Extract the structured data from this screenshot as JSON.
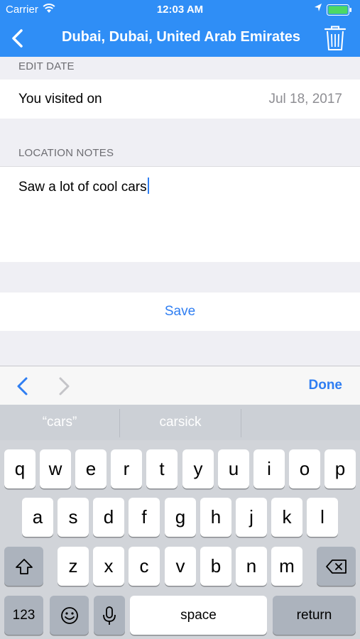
{
  "status_bar": {
    "carrier": "Carrier",
    "time": "12:03 AM"
  },
  "nav": {
    "title": "Dubai, Dubai, United Arab Emirates",
    "back_icon": "chevron-left-icon",
    "delete_icon": "trash-icon"
  },
  "edit_date": {
    "header": "EDIT DATE",
    "label": "You visited on",
    "value": "Jul 18, 2017"
  },
  "location_notes": {
    "header": "LOCATION NOTES",
    "text": "Saw a lot of cool cars"
  },
  "save_label": "Save",
  "toolbar": {
    "done_label": "Done"
  },
  "keyboard": {
    "suggestions": [
      "“cars”",
      "carsick",
      ""
    ],
    "row1": [
      "q",
      "w",
      "e",
      "r",
      "t",
      "y",
      "u",
      "i",
      "o",
      "p"
    ],
    "row2": [
      "a",
      "s",
      "d",
      "f",
      "g",
      "h",
      "j",
      "k",
      "l"
    ],
    "row3": [
      "z",
      "x",
      "c",
      "v",
      "b",
      "n",
      "m"
    ],
    "numbers_label": "123",
    "space_label": "space",
    "return_label": "return"
  },
  "colors": {
    "accent": "#2f8ef6",
    "link": "#2f7ef2",
    "background": "#efeff4"
  }
}
